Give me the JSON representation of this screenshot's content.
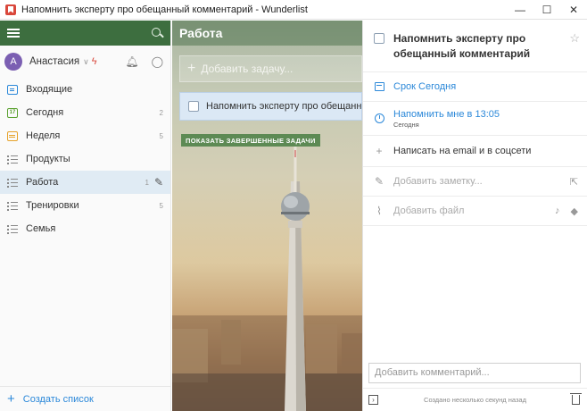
{
  "window": {
    "title": "Напомнить эксперту про обещанный комментарий - Wunderlist",
    "minimize": "—",
    "maximize": "☐",
    "close": "✕"
  },
  "sidebar": {
    "user": {
      "initial": "А",
      "name": "Анастасия",
      "avatar_color": "#7b5fb2"
    },
    "items": [
      {
        "label": "Входящие",
        "icon": "inbox-icon",
        "count": ""
      },
      {
        "label": "Сегодня",
        "icon": "today-icon",
        "icon_text": "17",
        "count": "2"
      },
      {
        "label": "Неделя",
        "icon": "week-icon",
        "count": "5"
      },
      {
        "label": "Продукты",
        "icon": "list-icon",
        "count": ""
      },
      {
        "label": "Работа",
        "icon": "list-icon",
        "count": "1"
      },
      {
        "label": "Тренировки",
        "icon": "list-icon",
        "count": "5"
      },
      {
        "label": "Семья",
        "icon": "list-icon",
        "count": ""
      }
    ],
    "create_list": "Создать список"
  },
  "main": {
    "header": "Работа",
    "add_task_placeholder": "Добавить задачу...",
    "tasks": [
      {
        "title": "Напомнить эксперту про обещанный комментарий"
      }
    ],
    "show_completed": "ПОКАЗАТЬ ЗАВЕРШЕННЫЕ ЗАДАЧИ"
  },
  "detail": {
    "title": "Напомнить эксперту про обещанный комментарий",
    "due": "Срок Сегодня",
    "reminder": "Напомнить мне в 13:05",
    "reminder_sub": "Сегодня",
    "subtask": "Написать на email  и в соцсети",
    "note_placeholder": "Добавить заметку...",
    "file_placeholder": "Добавить файл",
    "comment_placeholder": "Добавить комментарий...",
    "created": "Создано несколько секунд назад"
  },
  "colors": {
    "accent_green": "#3d6e3f",
    "accent_blue": "#2b88d9",
    "selected_bg": "#e0ebf4"
  }
}
